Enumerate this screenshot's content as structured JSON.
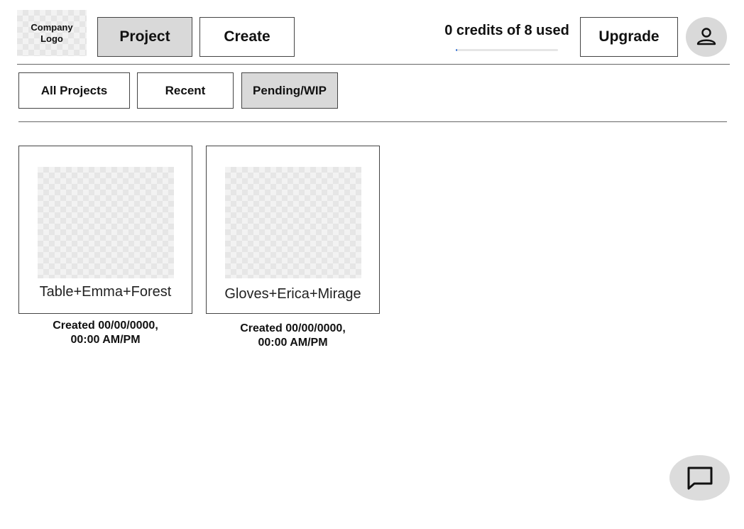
{
  "header": {
    "logo_line1": "Company",
    "logo_line2": "Logo",
    "nav": {
      "project_label": "Project",
      "create_label": "Create"
    },
    "credits": {
      "text": "0 credits of 8 used",
      "used": 0,
      "total": 8
    },
    "upgrade_label": "Upgrade",
    "avatar_icon": "user-icon"
  },
  "tabs": [
    {
      "label": "All Projects",
      "active": false
    },
    {
      "label": "Recent",
      "active": false
    },
    {
      "label": "Pending/WIP",
      "active": true
    }
  ],
  "projects": [
    {
      "name": "Table+Emma+Forest",
      "created_line1": "Created 00/00/0000,",
      "created_line2": "00:00 AM/PM"
    },
    {
      "name": "Gloves+Erica+Mirage",
      "created_line1": "Created 00/00/0000,",
      "created_line2": "00:00 AM/PM"
    }
  ],
  "chat_icon": "chat-bubble-icon",
  "colors": {
    "active_bg": "#d9d9d9",
    "progress_fill": "#2f6fd6",
    "border": "#444444"
  }
}
